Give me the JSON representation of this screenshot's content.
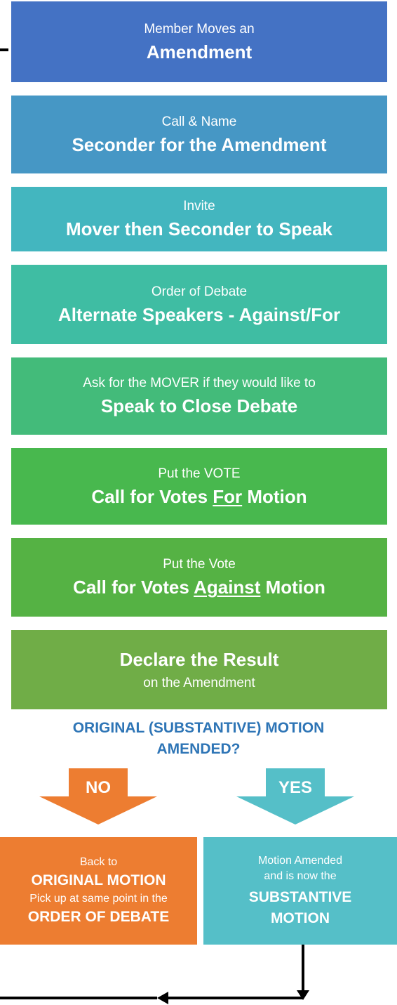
{
  "steps": [
    {
      "sub": "Member Moves an",
      "main": "Amendment",
      "color": "#4472c4"
    },
    {
      "sub": "Call & Name",
      "main": "Seconder for the Amendment",
      "color": "#4697c5"
    },
    {
      "sub": "Invite",
      "main": "Mover then Seconder to Speak",
      "color": "#43b6bf"
    },
    {
      "sub": "Order of Debate",
      "main": "Alternate Speakers - Against/For",
      "color": "#3fbda3"
    },
    {
      "sub": "Ask for the MOVER if they would like to",
      "main": "Speak to Close Debate",
      "color": "#43bb7a"
    },
    {
      "sub": "Put the VOTE",
      "main_pre": "Call for Votes ",
      "main_u": "For",
      "main_post": " Motion",
      "color": "#48b84e"
    },
    {
      "sub": "Put the Vote",
      "main_pre": "Call for Votes ",
      "main_u": "Against",
      "main_post": " Motion",
      "color": "#55b244"
    },
    {
      "main": "Declare the Result",
      "sub": "on the Amendment",
      "color": "#70ad47"
    }
  ],
  "question": {
    "line1": "ORIGINAL (SUBSTANTIVE) MOTION",
    "line2": "AMENDED?",
    "color": "#2e75b6"
  },
  "branches": {
    "no": {
      "label": "NO",
      "color": "#ed7d31",
      "lines": [
        "Back to",
        "ORIGINAL MOTION",
        "Pick up at same point in the",
        "ORDER OF DEBATE"
      ]
    },
    "yes": {
      "label": "YES",
      "color": "#55bfc8",
      "lines": [
        "Motion Amended",
        "and is now the",
        "SUBSTANTIVE",
        "MOTION"
      ]
    }
  }
}
